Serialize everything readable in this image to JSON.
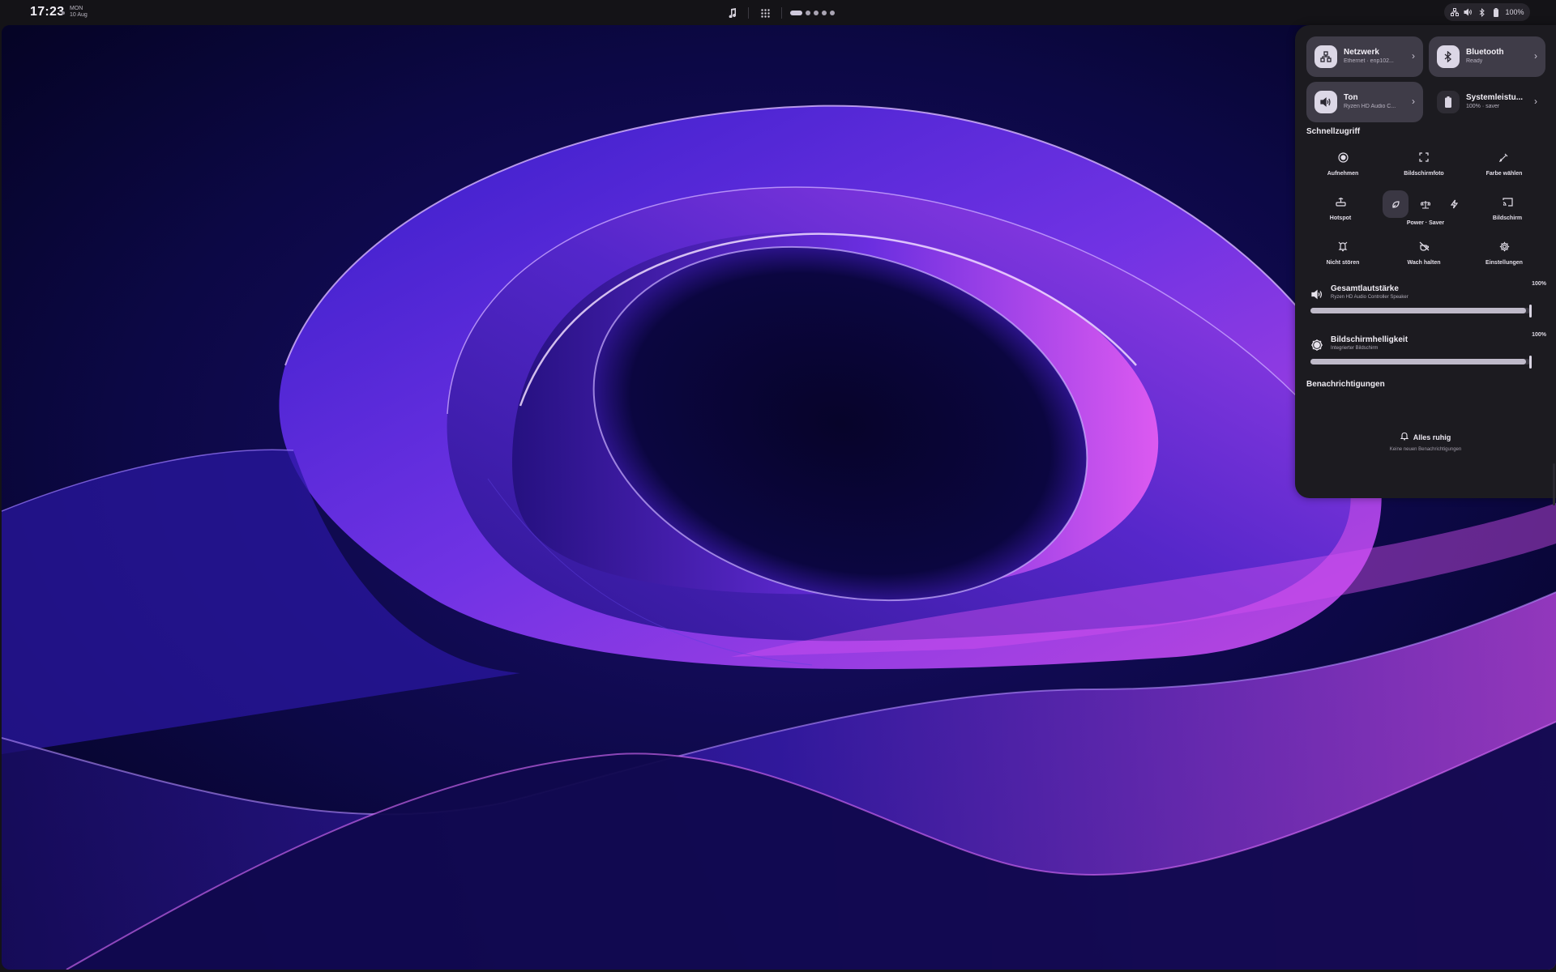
{
  "topbar": {
    "time": "17:23",
    "weekday": "MON",
    "date": "10 Aug",
    "music_icon": "music-note-icon",
    "apps_icon": "app-grid-icon",
    "workspaces": 5,
    "active_workspace": 1,
    "tray": {
      "battery": "100%"
    }
  },
  "panel": {
    "tiles": [
      {
        "title": "Netzwerk",
        "subtitle": "Ethernet · enp102...",
        "icon": "network-icon"
      },
      {
        "title": "Bluetooth",
        "subtitle": "Ready",
        "icon": "bluetooth-icon"
      },
      {
        "title": "Ton",
        "subtitle": "Ryzen HD Audio C...",
        "icon": "speaker-icon"
      },
      {
        "title": "Systemleistu...",
        "subtitle": "100% · saver",
        "icon": "battery-icon"
      }
    ],
    "quick_access_title": "Schnellzugriff",
    "quick_actions": {
      "record": "Aufnehmen",
      "screenshot": "Bildschirmfoto",
      "color_picker": "Farbe wählen",
      "hotspot": "Hotspot",
      "power_saver": "Power · Saver",
      "screen": "Bildschirm",
      "dnd": "Nicht stören",
      "keep_awake": "Wach halten",
      "settings": "Einstellungen"
    },
    "volume": {
      "title": "Gesamtlautstärke",
      "subtitle": "Ryzen HD Audio Controller Speaker",
      "percent": "100%",
      "level": 1.0
    },
    "brightness": {
      "title": "Bildschirmhelligkeit",
      "subtitle": "Integrierter Bildschirm",
      "percent": "100%",
      "level": 1.0
    },
    "notifications_title": "Benachrichtigungen",
    "notifications_empty_title": "Alles ruhig",
    "notifications_empty_subtitle": "Keine neuen Benachrichtigungen"
  },
  "colors": {
    "accent": "#dcd7e6",
    "panel": "#1c1b20",
    "wallpaper_base": "#0a0836",
    "wallpaper_glow": "#b34cff"
  }
}
